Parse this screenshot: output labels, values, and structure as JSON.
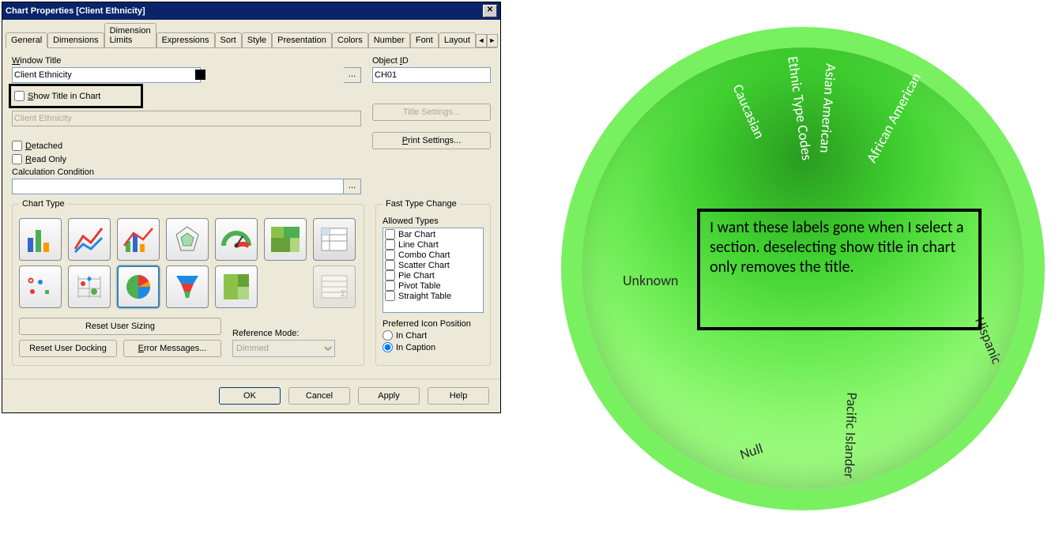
{
  "dialog": {
    "title": "Chart Properties [Client Ethnicity]",
    "tabs": [
      "General",
      "Dimensions",
      "Dimension Limits",
      "Expressions",
      "Sort",
      "Style",
      "Presentation",
      "Colors",
      "Number",
      "Font",
      "Layout"
    ],
    "active_tab": 0,
    "window_title_label": "Window Title",
    "window_title_value": "Client Ethnicity",
    "object_id_label": "Object ID",
    "object_id_value": "CH01",
    "show_title_label": "Show Title in Chart",
    "show_title_checked": false,
    "title_in_chart_value": "Client Ethnicity",
    "title_settings_label": "Title Settings...",
    "print_settings_label": "Print Settings...",
    "detached_label": "Detached",
    "detached_checked": false,
    "readonly_label": "Read Only",
    "readonly_checked": false,
    "calc_cond_label": "Calculation Condition",
    "calc_cond_value": "",
    "chart_type_legend": "Chart Type",
    "reset_sizing_label": "Reset User Sizing",
    "reset_docking_label": "Reset User Docking",
    "error_msgs_label": "Error Messages...",
    "ref_mode_label": "Reference Mode:",
    "ref_mode_value": "Dimmed",
    "fast_legend": "Fast Type Change",
    "allowed_label": "Allowed Types",
    "allowed_types": [
      "Bar Chart",
      "Line Chart",
      "Combo Chart",
      "Scatter Chart",
      "Pie Chart",
      "Pivot Table",
      "Straight Table"
    ],
    "pref_icon_label": "Preferred Icon Position",
    "radio_in_chart": "In Chart",
    "radio_in_caption": "In Caption",
    "radio_selected": "caption",
    "ok": "OK",
    "cancel": "Cancel",
    "apply": "Apply",
    "help": "Help",
    "dots": "..."
  },
  "chart_data": {
    "type": "pie",
    "title": "",
    "labels": [
      "Caucasian",
      "Ethnic Type Codes",
      "Asian American",
      "African American",
      "Hispanic",
      "Pacific Islander",
      "Null",
      "Unknown"
    ],
    "note": "pie slice values not shown in image; only dimension labels are rendered"
  },
  "annotation": "I want these labels gone when I select a section. deselecting show title in chart only removes the title."
}
